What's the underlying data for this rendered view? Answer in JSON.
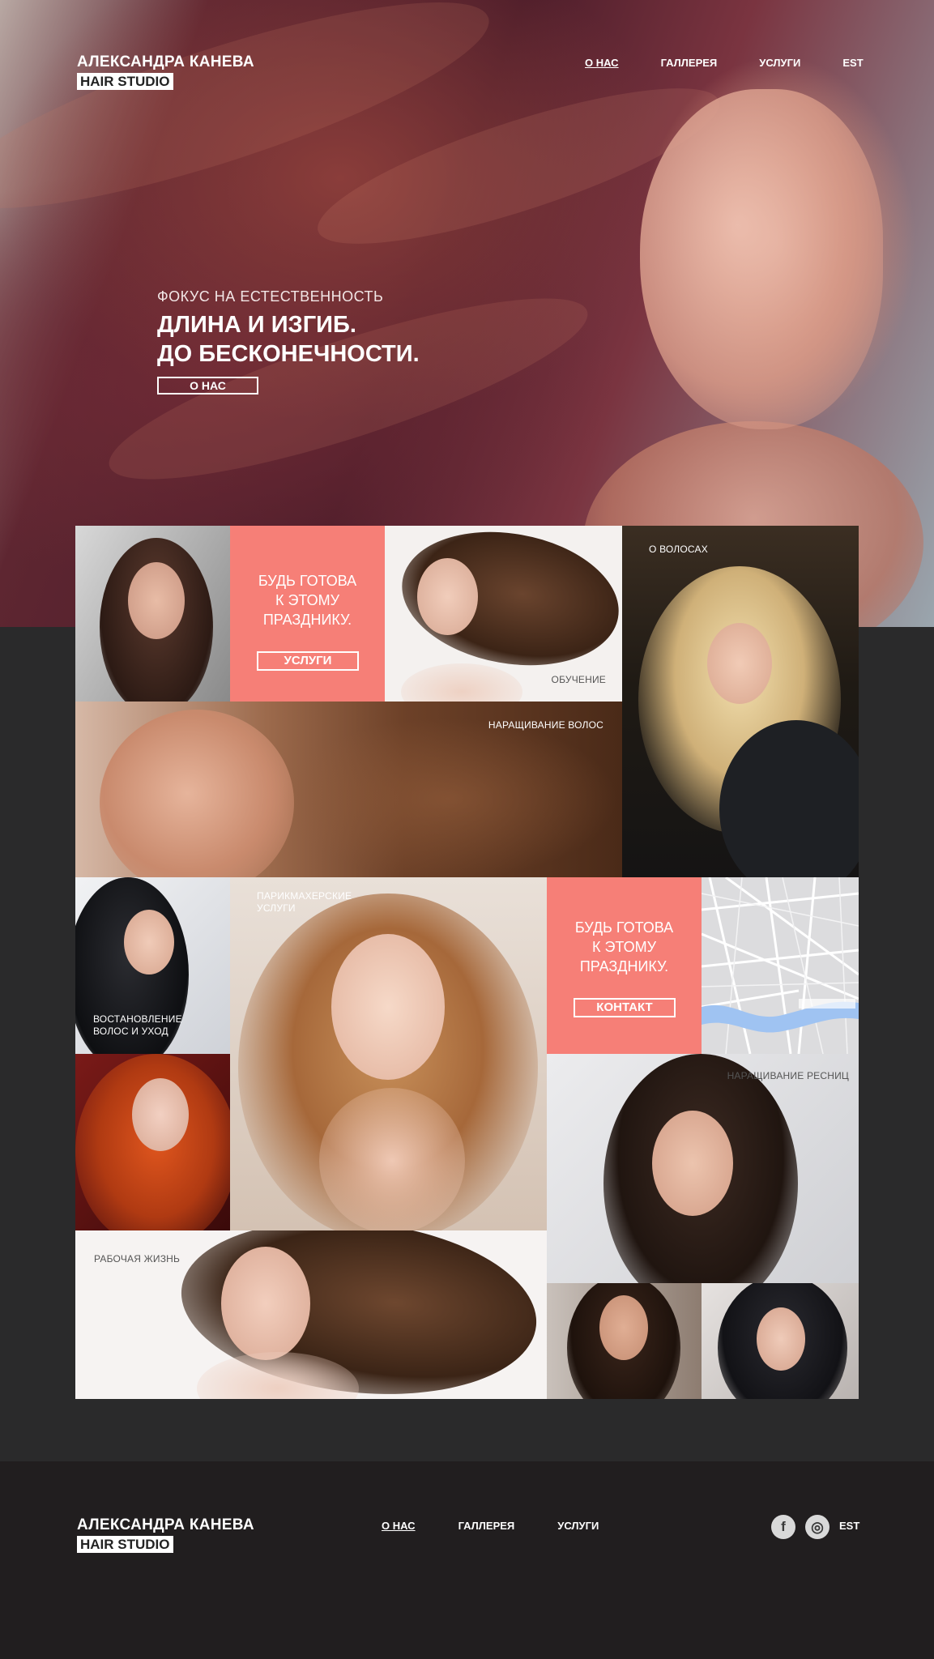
{
  "brand": {
    "name": "АЛЕКСАНДРА КАНЕВА",
    "tagline": "HAIR STUDIO"
  },
  "nav": {
    "items": [
      "О НАС",
      "ГАЛЛЕРЕЯ",
      "УСЛУГИ"
    ],
    "lang": "EST"
  },
  "hero": {
    "kicker": "ФОКУС НА ЕСТЕСТВЕННОСТЬ",
    "headline_1": "ДЛИНА И ИЗГИБ.",
    "headline_2": "ДО БЕСКОНЕЧНОСТИ.",
    "button": "О НАС"
  },
  "mosaic": {
    "promo_1": {
      "line_1": "БУДЬ ГОТОВА",
      "line_2": "К ЭТОМУ",
      "line_3": "ПРАЗДНИКУ.",
      "button": "УСЛУГИ"
    },
    "promo_2": {
      "line_1": "БУДЬ ГОТОВА",
      "line_2": "К ЭТОМУ",
      "line_3": "ПРАЗДНИКУ.",
      "button": "КОНТАКТ"
    },
    "labels": {
      "training": "ОБУЧЕНИЕ",
      "about_hair": "О ВОЛОСАХ",
      "extensions": "НАРАЩИВАНИЕ ВОЛОС",
      "hairdressing_1": "ПАРИКМАХЕРСКИЕ",
      "hairdressing_2": "УСЛУГИ",
      "restoration_1": "ВОСТАНОВЛЕНИЕ",
      "restoration_2": "ВОЛОС И УХОД",
      "lashes": "НАРАЩИВАНИЕ РЕСНИЦ",
      "work_life": "РАБОЧАЯ ЖИЗНЬ"
    }
  },
  "footer": {
    "nav": [
      "О НАС",
      "ГАЛЛЕРЕЯ",
      "УСЛУГИ"
    ],
    "social": {
      "facebook_icon": "f",
      "instagram_icon": "◎"
    },
    "lang": "EST"
  },
  "colors": {
    "accent": "#f67f77",
    "page_bg": "#2a2a2b",
    "footer_bg": "#211e1f"
  }
}
